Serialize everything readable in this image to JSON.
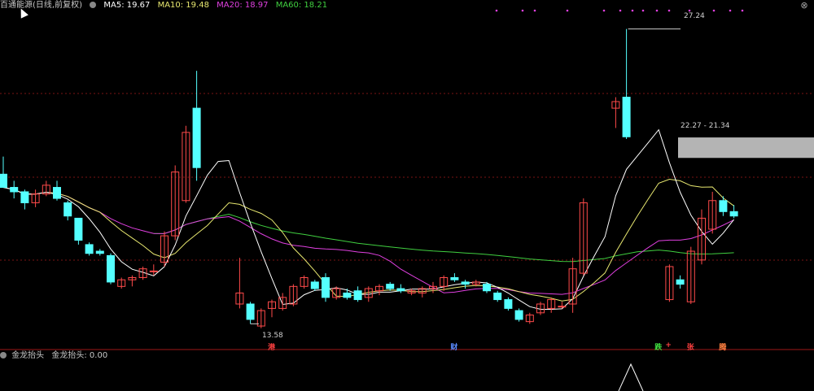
{
  "header": {
    "title": "百通能源(日线,前复权)",
    "ma": [
      {
        "label": "MA5: 19.67",
        "color": "#ffffff"
      },
      {
        "label": "MA10: 19.48",
        "color": "#e8e870"
      },
      {
        "label": "MA20: 18.97",
        "color": "#e040e0"
      },
      {
        "label": "MA60: 18.21",
        "color": "#40d040"
      }
    ]
  },
  "indicator": {
    "name": "金龙抬头",
    "value": "金龙抬头: 0.00"
  },
  "annotations": {
    "high": "27.24",
    "low": "13.58",
    "band": "22.27 - 21.34"
  },
  "event_markers": [
    {
      "text": "港",
      "color": "#ff4040",
      "candle": 25
    },
    {
      "text": "财",
      "color": "#5a8cff",
      "candle": 42
    },
    {
      "text": "跌",
      "color": "#40e040",
      "candle": 61
    },
    {
      "text": "+",
      "color": "#ff4040",
      "candle": 62
    },
    {
      "text": "张",
      "color": "#ff4040",
      "candle": 64
    },
    {
      "text": "腾",
      "color": "#ff8040",
      "candle": 67
    }
  ],
  "chart_data": {
    "type": "candlestick",
    "ylim": [
      13.0,
      28.0
    ],
    "up_color": "#ff4a4a",
    "down_color": "#54ffff",
    "candles": [
      {
        "o": 20.6,
        "h": 21.4,
        "l": 20.0,
        "c": 20.0
      },
      {
        "o": 20.0,
        "h": 20.3,
        "l": 19.5,
        "c": 19.8
      },
      {
        "o": 19.8,
        "h": 19.9,
        "l": 19.0,
        "c": 19.3
      },
      {
        "o": 19.3,
        "h": 19.9,
        "l": 19.1,
        "c": 19.7
      },
      {
        "o": 19.7,
        "h": 20.3,
        "l": 19.6,
        "c": 20.1
      },
      {
        "o": 20.0,
        "h": 20.3,
        "l": 19.4,
        "c": 19.5
      },
      {
        "o": 19.3,
        "h": 19.4,
        "l": 18.5,
        "c": 18.7
      },
      {
        "o": 18.6,
        "h": 18.6,
        "l": 17.4,
        "c": 17.6
      },
      {
        "o": 17.4,
        "h": 17.5,
        "l": 16.9,
        "c": 17.0
      },
      {
        "o": 17.1,
        "h": 17.2,
        "l": 16.9,
        "c": 17.0
      },
      {
        "o": 16.9,
        "h": 17.0,
        "l": 15.6,
        "c": 15.7
      },
      {
        "o": 15.5,
        "h": 15.9,
        "l": 15.4,
        "c": 15.8
      },
      {
        "o": 15.8,
        "h": 16.0,
        "l": 15.5,
        "c": 15.9
      },
      {
        "o": 15.9,
        "h": 16.4,
        "l": 15.8,
        "c": 16.3
      },
      {
        "o": 16.2,
        "h": 16.5,
        "l": 16.0,
        "c": 16.2
      },
      {
        "o": 16.6,
        "h": 18.0,
        "l": 16.4,
        "c": 17.8
      },
      {
        "o": 17.8,
        "h": 21.0,
        "l": 17.6,
        "c": 20.7
      },
      {
        "o": 19.4,
        "h": 22.8,
        "l": 19.3,
        "c": 22.5
      },
      {
        "o": 23.6,
        "h": 25.3,
        "l": 20.3,
        "c": 20.9
      },
      {
        "o": 0,
        "h": 0,
        "l": 0,
        "c": 0,
        "skip": true
      },
      {
        "o": 0,
        "h": 0,
        "l": 0,
        "c": 0,
        "skip": true
      },
      {
        "o": 0,
        "h": 0,
        "l": 0,
        "c": 0,
        "skip": true
      },
      {
        "o": 14.7,
        "h": 16.8,
        "l": 14.5,
        "c": 15.2
      },
      {
        "o": 14.7,
        "h": 14.8,
        "l": 13.8,
        "c": 14.0
      },
      {
        "o": 13.7,
        "h": 14.5,
        "l": 13.6,
        "c": 14.4
      },
      {
        "o": 14.5,
        "h": 14.9,
        "l": 14.1,
        "c": 14.8
      },
      {
        "o": 14.5,
        "h": 15.2,
        "l": 14.4,
        "c": 15.0
      },
      {
        "o": 14.7,
        "h": 15.6,
        "l": 14.6,
        "c": 15.5
      },
      {
        "o": 15.5,
        "h": 16.0,
        "l": 15.4,
        "c": 15.9
      },
      {
        "o": 15.7,
        "h": 15.8,
        "l": 15.3,
        "c": 15.4
      },
      {
        "o": 15.9,
        "h": 16.1,
        "l": 14.8,
        "c": 15.0
      },
      {
        "o": 15.0,
        "h": 15.5,
        "l": 14.9,
        "c": 15.4
      },
      {
        "o": 15.2,
        "h": 15.4,
        "l": 14.9,
        "c": 15.0
      },
      {
        "o": 15.3,
        "h": 15.5,
        "l": 14.8,
        "c": 14.9
      },
      {
        "o": 15.0,
        "h": 15.5,
        "l": 14.8,
        "c": 15.4
      },
      {
        "o": 15.3,
        "h": 15.6,
        "l": 15.1,
        "c": 15.5
      },
      {
        "o": 15.6,
        "h": 15.7,
        "l": 15.3,
        "c": 15.4
      },
      {
        "o": 15.4,
        "h": 15.6,
        "l": 15.2,
        "c": 15.3
      },
      {
        "o": 15.2,
        "h": 15.4,
        "l": 15.1,
        "c": 15.3
      },
      {
        "o": 15.2,
        "h": 15.5,
        "l": 15.0,
        "c": 15.4
      },
      {
        "o": 15.4,
        "h": 15.7,
        "l": 15.2,
        "c": 15.5
      },
      {
        "o": 15.5,
        "h": 16.0,
        "l": 15.3,
        "c": 15.9
      },
      {
        "o": 15.9,
        "h": 16.1,
        "l": 15.7,
        "c": 15.8
      },
      {
        "o": 15.7,
        "h": 15.8,
        "l": 15.4,
        "c": 15.6
      },
      {
        "o": 15.6,
        "h": 15.8,
        "l": 15.5,
        "c": 15.7
      },
      {
        "o": 15.6,
        "h": 15.7,
        "l": 15.2,
        "c": 15.3
      },
      {
        "o": 15.2,
        "h": 15.3,
        "l": 14.8,
        "c": 14.9
      },
      {
        "o": 14.9,
        "h": 15.0,
        "l": 14.4,
        "c": 14.5
      },
      {
        "o": 14.4,
        "h": 14.5,
        "l": 13.9,
        "c": 14.0
      },
      {
        "o": 13.9,
        "h": 14.3,
        "l": 13.8,
        "c": 14.2
      },
      {
        "o": 14.3,
        "h": 14.8,
        "l": 14.2,
        "c": 14.7
      },
      {
        "o": 14.5,
        "h": 15.0,
        "l": 14.3,
        "c": 14.9
      },
      {
        "o": 14.6,
        "h": 14.8,
        "l": 14.5,
        "c": 14.6
      },
      {
        "o": 14.7,
        "h": 16.8,
        "l": 14.3,
        "c": 16.3
      },
      {
        "o": 16.1,
        "h": 19.5,
        "l": 16.0,
        "c": 19.3
      },
      {
        "o": 0,
        "h": 0,
        "l": 0,
        "c": 0,
        "skip": true
      },
      {
        "o": 0,
        "h": 0,
        "l": 0,
        "c": 0,
        "skip": true
      },
      {
        "o": 23.6,
        "h": 24.1,
        "l": 22.7,
        "c": 23.9
      },
      {
        "o": 24.1,
        "h": 27.2,
        "l": 22.2,
        "c": 22.3
      },
      {
        "o": 0,
        "h": 0,
        "l": 0,
        "c": 0,
        "skip": true
      },
      {
        "o": 0,
        "h": 0,
        "l": 0,
        "c": 0,
        "skip": true
      },
      {
        "o": 0,
        "h": 0,
        "l": 0,
        "c": 0,
        "skip": true
      },
      {
        "o": 14.9,
        "h": 16.5,
        "l": 14.8,
        "c": 16.4
      },
      {
        "o": 15.8,
        "h": 16.0,
        "l": 15.4,
        "c": 15.6
      },
      {
        "o": 14.8,
        "h": 17.3,
        "l": 14.7,
        "c": 17.1
      },
      {
        "o": 16.7,
        "h": 19.0,
        "l": 16.5,
        "c": 18.6
      },
      {
        "o": 18.1,
        "h": 19.8,
        "l": 17.9,
        "c": 19.4
      },
      {
        "o": 19.4,
        "h": 19.6,
        "l": 18.7,
        "c": 18.9
      },
      {
        "o": 18.9,
        "h": 19.2,
        "l": 18.6,
        "c": 18.7
      }
    ]
  }
}
